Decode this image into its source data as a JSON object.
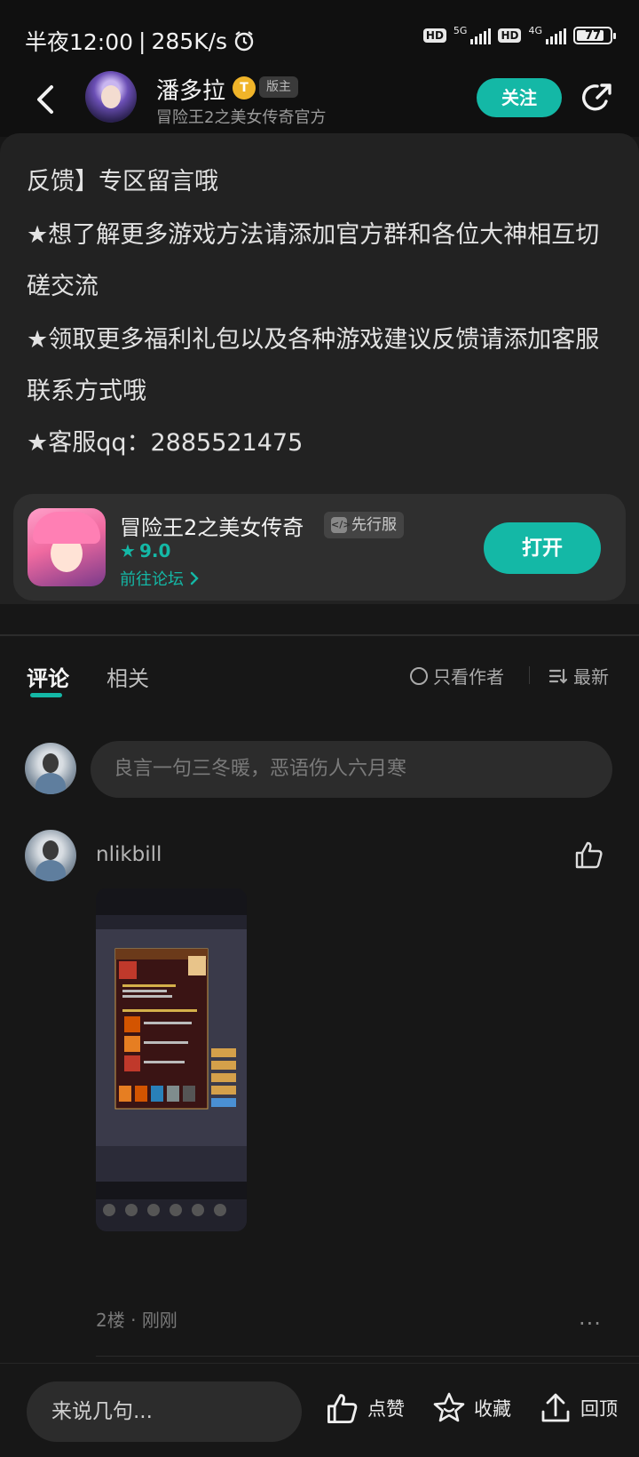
{
  "status_bar": {
    "time": "半夜12:00",
    "speed": "285K/s",
    "hd1": "HD",
    "net1": "5G",
    "hd2": "HD",
    "net2": "4G",
    "battery": "77"
  },
  "header": {
    "author_name": "潘多拉",
    "level": "T",
    "role_badge": "版主",
    "subtitle": "冒险王2之美女传奇官方",
    "follow_label": "关注"
  },
  "article": {
    "paragraphs": [
      "反馈】专区留言哦",
      "★想了解更多游戏方法请添加官方群和各位大神相互切磋交流",
      "★领取更多福利礼包以及各种游戏建议反馈请添加客服联系方式哦",
      "★客服qq：2885521475"
    ]
  },
  "game_card": {
    "name": "冒险王2之美女传奇",
    "server_badge": "先行服",
    "rating": "9.0",
    "forum_link": "前往论坛",
    "open_label": "打开"
  },
  "tabs": {
    "comments": "评论",
    "related": "相关",
    "author_only": "只看作者",
    "sort": "最新"
  },
  "comment_input": {
    "placeholder": "良言一句三冬暖，恶语伤人六月寒"
  },
  "comment": {
    "username": "nlikbill",
    "floor": "2楼",
    "time": "刚刚",
    "more": "···"
  },
  "bottom_bar": {
    "input_placeholder": "来说几句...",
    "like_label": "点赞",
    "fav_label": "收藏",
    "top_label": "回顶"
  },
  "colors": {
    "accent": "#14b8a6",
    "background": "#171717",
    "card": "#2f2f2f"
  }
}
